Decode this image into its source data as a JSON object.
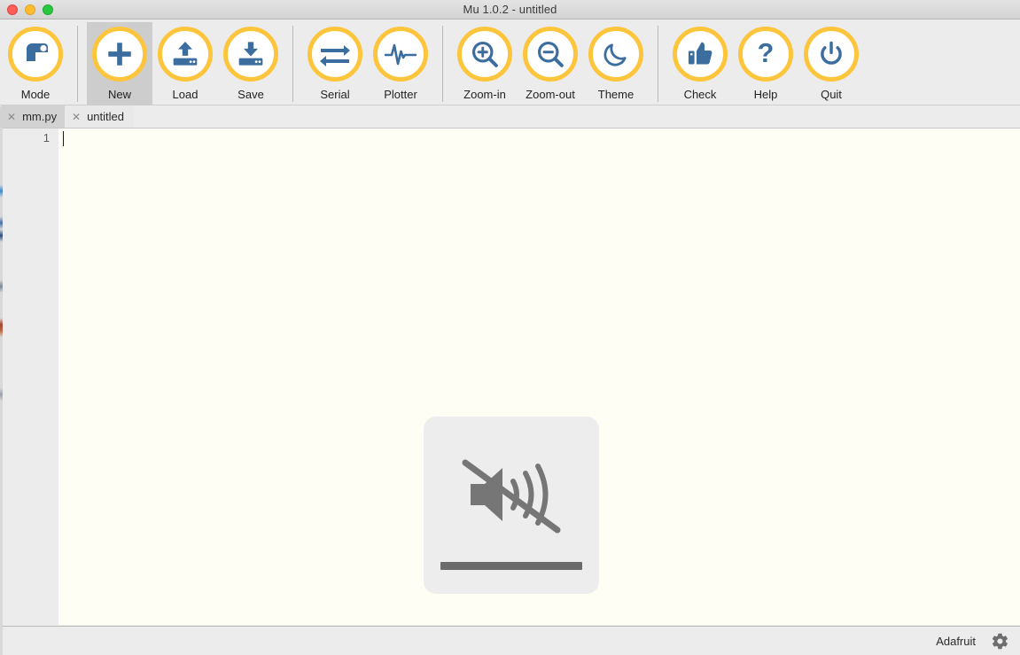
{
  "window": {
    "title": "Mu 1.0.2 - untitled",
    "traffic_lights": [
      {
        "name": "close",
        "color": "#ff5f57"
      },
      {
        "name": "minimize",
        "color": "#ffbd2e"
      },
      {
        "name": "maximize",
        "color": "#28c940"
      }
    ]
  },
  "theme": {
    "accent_yellow": "#fdc53c",
    "icon_blue": "#3b6e9f",
    "toolbar_bg": "#ececec",
    "editor_bg": "#fffef4",
    "active_button_bg": "#cdcdcd",
    "hud_bg": "#ededed",
    "hud_glyph": "#6b6b6b"
  },
  "toolbar": {
    "buttons": [
      {
        "label": "Mode",
        "icon": "python-snake-icon",
        "active": false,
        "separator_after": true
      },
      {
        "label": "New",
        "icon": "plus-icon",
        "active": true,
        "separator_after": false
      },
      {
        "label": "Load",
        "icon": "upload-drive-icon",
        "active": false,
        "separator_after": false
      },
      {
        "label": "Save",
        "icon": "download-drive-icon",
        "active": false,
        "separator_after": true
      },
      {
        "label": "Serial",
        "icon": "exchange-arrows-icon",
        "active": false,
        "separator_after": false
      },
      {
        "label": "Plotter",
        "icon": "waveform-icon",
        "active": false,
        "separator_after": true
      },
      {
        "label": "Zoom-in",
        "icon": "magnifier-plus-icon",
        "active": false,
        "separator_after": false
      },
      {
        "label": "Zoom-out",
        "icon": "magnifier-minus-icon",
        "active": false,
        "separator_after": false
      },
      {
        "label": "Theme",
        "icon": "moon-icon",
        "active": false,
        "separator_after": true
      },
      {
        "label": "Check",
        "icon": "thumbs-up-icon",
        "active": false,
        "separator_after": false
      },
      {
        "label": "Help",
        "icon": "question-mark-icon",
        "active": false,
        "separator_after": false
      },
      {
        "label": "Quit",
        "icon": "power-icon",
        "active": false,
        "separator_after": false
      }
    ]
  },
  "tabs": [
    {
      "label": "mm.py",
      "active": false,
      "close_glyph": "✕"
    },
    {
      "label": "untitled",
      "active": true,
      "close_glyph": "✕"
    }
  ],
  "editor": {
    "line_numbers": [
      "1"
    ],
    "lines": [
      ""
    ],
    "caret_line": 1
  },
  "overlay": {
    "type": "volume-mute-hud",
    "icon": "speaker-muted-icon",
    "level_label": ""
  },
  "statusbar": {
    "mode_label": "Adafruit",
    "settings_icon": "gear-icon"
  }
}
